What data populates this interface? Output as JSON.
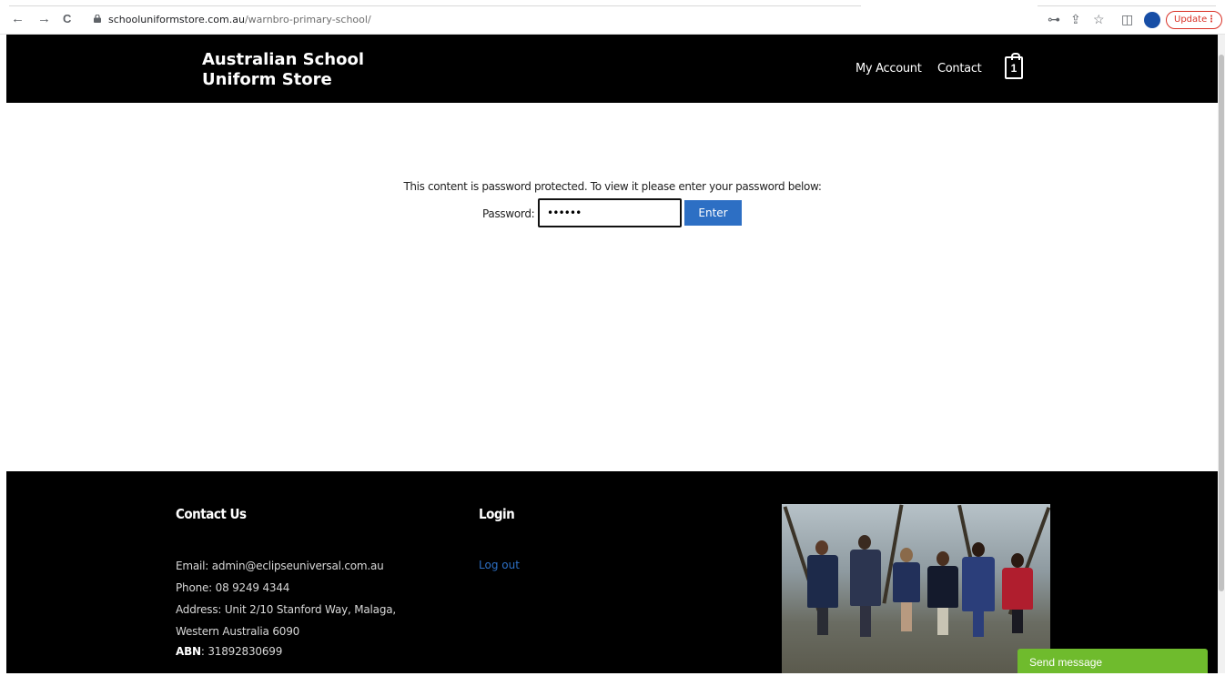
{
  "browser": {
    "back_icon": "←",
    "forward_icon": "→",
    "reload_icon": "C",
    "url_domain": "schooluniformstore.com.au",
    "url_path": "/warnbro-primary-school/",
    "key_icon": "⊶",
    "share_icon": "⇪",
    "star_icon": "☆",
    "sidepanel_icon": "◫",
    "update_label": "Update",
    "menu_icon": "⋮"
  },
  "header": {
    "brand_line1": "Australian School",
    "brand_line2": "Uniform Store",
    "nav": {
      "my_account": "My Account",
      "contact": "Contact"
    },
    "cart_count": "1"
  },
  "main": {
    "message": "This content is password protected. To view it please enter your password below:",
    "password_label": "Password:",
    "password_value": "••••••",
    "enter_label": "Enter"
  },
  "footer": {
    "contact_heading": "Contact Us",
    "email": "Email: admin@eclipseuniversal.com.au",
    "phone": "Phone: 08 9249 4344",
    "address_line1": "Address: Unit 2/10 Stanford Way, Malaga,",
    "address_line2": "Western Australia 6090",
    "abn_label": "ABN",
    "abn_value": ": 31892830699",
    "login_heading": "Login",
    "logout_label": "Log out"
  },
  "chat": {
    "send_message_label": "Send message"
  },
  "colors": {
    "header_bg": "#000000",
    "enter_button": "#2d6fc4",
    "link": "#2d6fc4",
    "chat_button": "#6fbb2d"
  }
}
